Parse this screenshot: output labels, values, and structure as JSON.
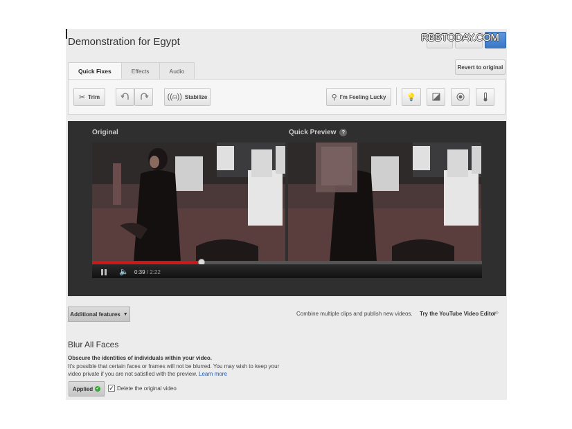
{
  "page": {
    "title": "Demonstration for Egypt",
    "watermark": "RBBTODAY.COM"
  },
  "tabs": [
    {
      "label": "Quick Fixes",
      "active": true
    },
    {
      "label": "Effects",
      "active": false
    },
    {
      "label": "Audio",
      "active": false
    }
  ],
  "revert_label": "Revert to original",
  "toolbar": {
    "trim": "Trim",
    "stabilize": "Stabilize",
    "feeling_lucky": "I'm Feeling Lucky"
  },
  "preview": {
    "original_label": "Original",
    "quick_preview_label": "Quick Preview",
    "help_glyph": "?",
    "progress_fraction": 0.28,
    "current_time": "0:39",
    "separator": " / ",
    "duration": "2:22"
  },
  "features": {
    "additional_label": "Additional features",
    "combine_text": "Combine multiple clips and publish new videos.",
    "try_editor": "Try the YouTube Video Editor"
  },
  "blur": {
    "heading": "Blur All Faces",
    "subheading": "Obscure the identities of individuals within your video.",
    "description": "It's possible that certain faces or frames will not be blurred. You may wish to keep your video private if you are not satisfied with the preview.",
    "learn_more": "Learn more",
    "applied_label": "Applied",
    "delete_label": "Delete the original video",
    "delete_checked": true
  },
  "colors": {
    "accent_blue": "#3a77c7",
    "progress_red": "#c81a1a",
    "ok_green": "#3aa53a"
  }
}
